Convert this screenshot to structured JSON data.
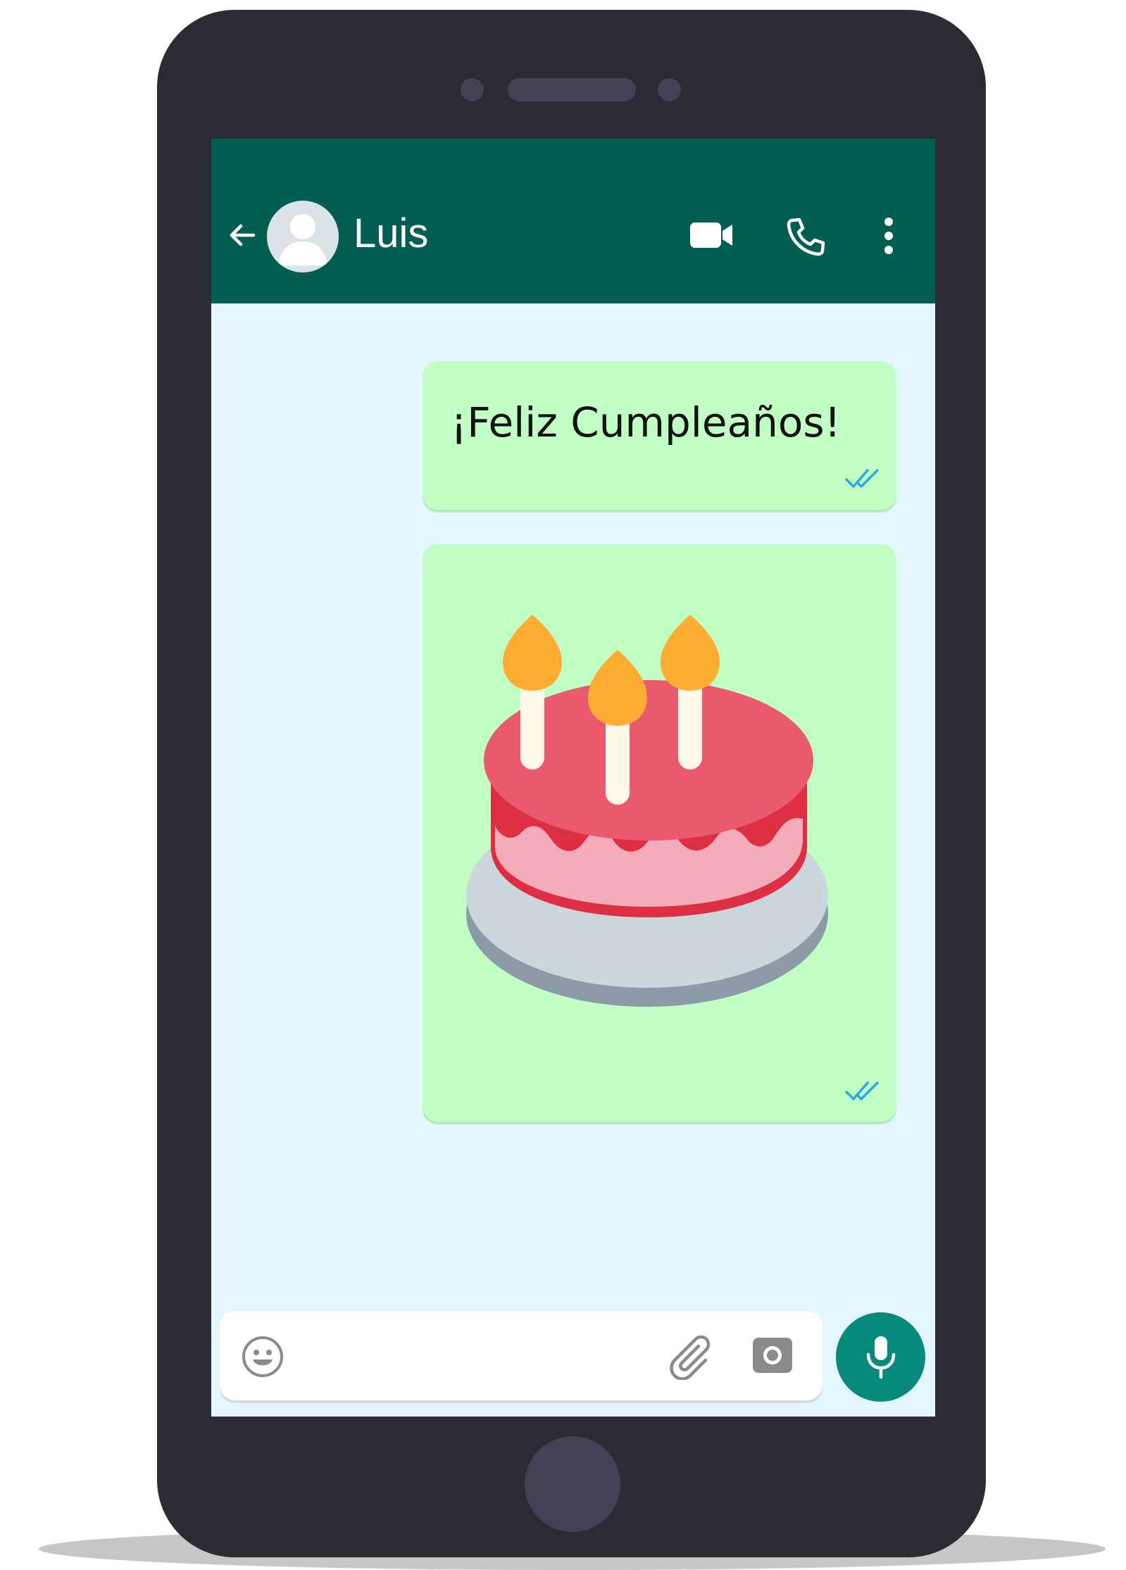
{
  "chat": {
    "contact_name": "Luis",
    "messages": [
      {
        "type": "text",
        "text": "¡Feliz Cumpleaños!",
        "status_icon": "double-check-icon"
      },
      {
        "type": "image",
        "content_icon": "birthday-cake-icon",
        "status_icon": "double-check-icon"
      }
    ]
  },
  "header_icons": [
    "back-arrow-icon",
    "avatar",
    "video-camera-icon",
    "phone-icon",
    "more-options-icon"
  ],
  "input_icons": [
    "emoji-icon",
    "paperclip-icon",
    "camera-icon",
    "microphone-icon"
  ],
  "colors": {
    "header": "#025e52",
    "chat_background": "#e3f5fd",
    "bubble": "#c0fec3",
    "mic_button": "#07897b",
    "read_ticks": "#2aa8e0"
  }
}
